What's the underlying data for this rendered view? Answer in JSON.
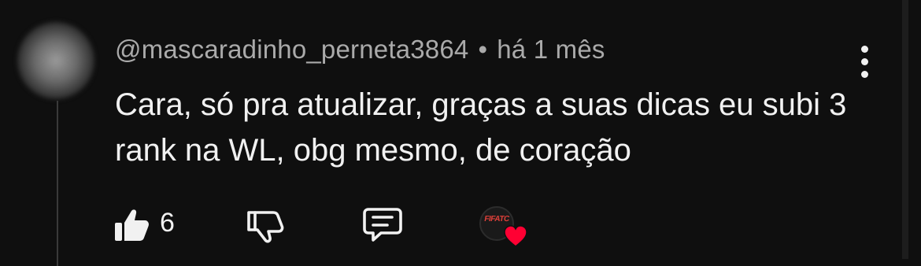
{
  "comment": {
    "author": "@mascaradinho_perneta3864",
    "separator": "•",
    "timestamp": "há 1 mês",
    "text": "Cara, só pra atualizar, graças a suas dicas eu subi 3 rank na WL, obg mesmo, de coração",
    "like_count": "6"
  },
  "creator": {
    "logo_text": "FIFATC"
  },
  "icons": {
    "like": "thumbs-up-filled",
    "dislike": "thumbs-down-outline",
    "reply": "speech-bubble",
    "more": "vertical-ellipsis",
    "heart": "red-heart"
  },
  "colors": {
    "background": "#0f0f0f",
    "text_primary": "#f1f1f1",
    "text_secondary": "#aaaaaa",
    "heart": "#ff0033"
  }
}
